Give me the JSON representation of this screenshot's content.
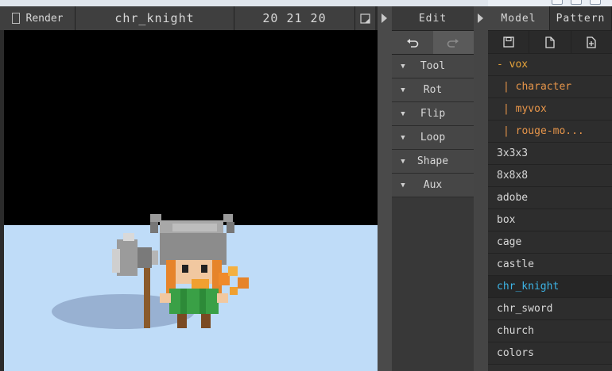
{
  "header": {
    "render_label": "Render",
    "model_name": "chr_knight",
    "dims": "20 21 20"
  },
  "edit": {
    "title": "Edit",
    "sections": [
      {
        "label": "Tool"
      },
      {
        "label": "Rot"
      },
      {
        "label": "Flip"
      },
      {
        "label": "Loop"
      },
      {
        "label": "Shape"
      },
      {
        "label": "Aux"
      }
    ]
  },
  "model_panel": {
    "tabs": [
      {
        "label": "Model"
      },
      {
        "label": "Pattern"
      }
    ],
    "folder": "- vox",
    "subfolders": [
      "| character",
      "| myvox",
      "| rouge-mo..."
    ],
    "files": [
      "3x3x3",
      "8x8x8",
      "adobe",
      "box",
      "cage",
      "castle",
      "chr_knight",
      "chr_sword",
      "church",
      "colors"
    ],
    "selected": "chr_knight",
    "colors": {
      "folder": "#e6a33a",
      "selected": "#3db4e6"
    }
  },
  "viewport": {
    "floor_color": "#bfdcf8",
    "background_color": "#000000"
  }
}
